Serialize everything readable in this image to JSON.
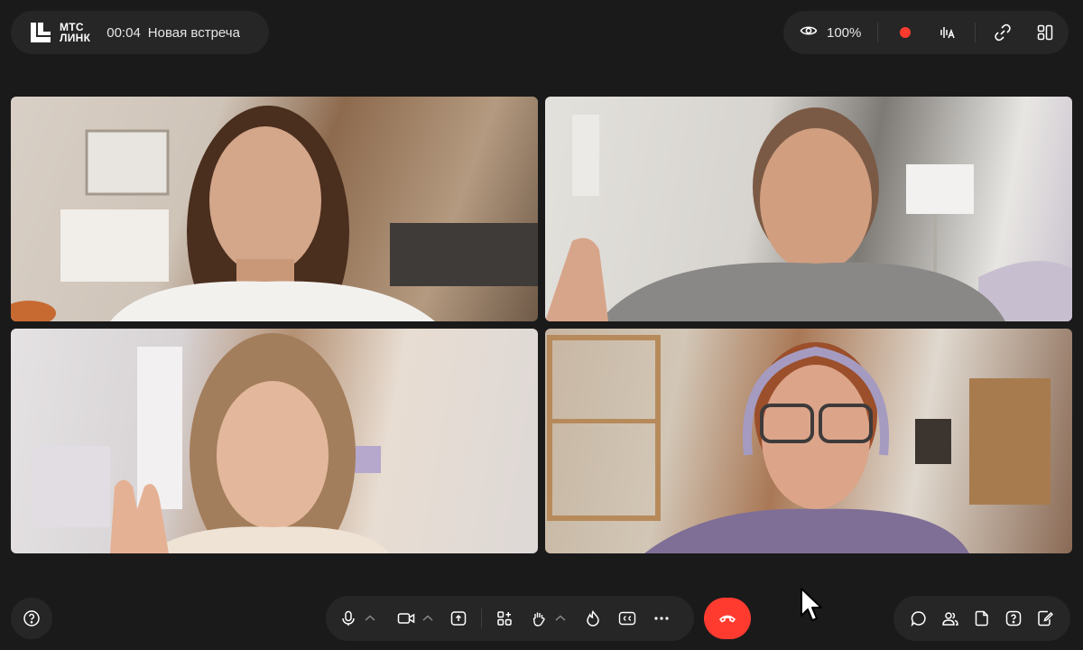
{
  "brand": {
    "line1": "МТС",
    "line2": "ЛИНК"
  },
  "meeting": {
    "timer": "00:04",
    "title": "Новая встреча"
  },
  "status": {
    "zoom": "100%",
    "recording": true
  },
  "participants": [
    {
      "icon": "participant-video"
    },
    {
      "icon": "participant-video"
    },
    {
      "icon": "participant-video"
    },
    {
      "icon": "participant-video"
    }
  ],
  "toolbar_icons": {
    "top": [
      "eye-icon",
      "record-icon",
      "captions-audio-icon",
      "link-icon",
      "layout-icon"
    ],
    "bottom_center": [
      "microphone-icon",
      "camera-icon",
      "share-screen-icon",
      "apps-icon",
      "raise-hand-icon",
      "reaction-icon",
      "cc-icon",
      "more-icon"
    ],
    "bottom_right": [
      "chat-icon",
      "participants-icon",
      "files-icon",
      "questions-icon",
      "notes-icon"
    ]
  },
  "colors": {
    "background": "#1a1a1a",
    "panel": "#262626",
    "accent_red": "#ff3b30"
  }
}
